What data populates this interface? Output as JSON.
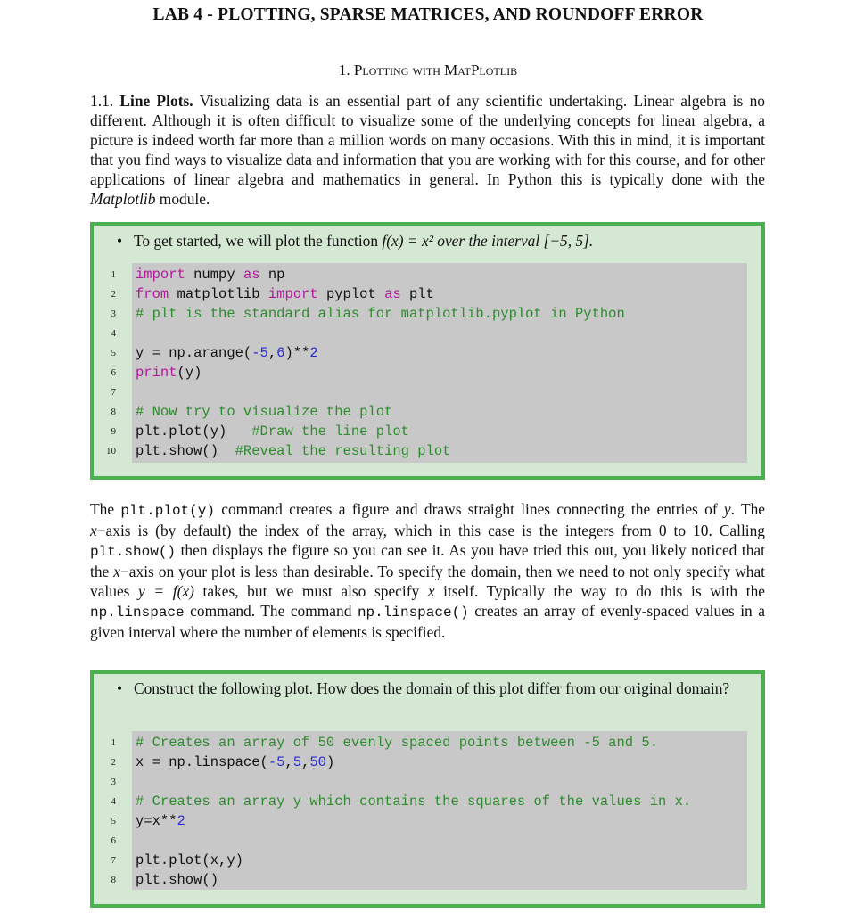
{
  "document": {
    "title": "LAB 4 - PLOTTING, SPARSE MATRICES, AND ROUNDOFF ERROR",
    "section": {
      "number": "1.",
      "title": "Plotting with MatPlotlib"
    },
    "subsection": {
      "number": "1.1.",
      "title": "Line Plots.",
      "text_before_italic": "Visualizing data is an essential part of any scientific undertaking. Linear algebra is no different. Although it is often difficult to visualize some of the underlying concepts for linear algebra, a picture is indeed worth far more than a million words on many occasions. With this in mind, it is important that you find ways to visualize data and information that you are working with for this course, and for other applications of linear algebra and mathematics in general. In Python this is typically done with the",
      "italic": "Matplotlib",
      "text_after_italic": "module."
    },
    "box1": {
      "bullet_symbol": "•",
      "bullet_text_a": "To get started, we will plot the function ",
      "bullet_math": "f(x) = x² over the interval [−5, 5].",
      "code_lines": [
        {
          "n": "1",
          "parts": [
            {
              "t": "import",
              "c": "kw"
            },
            {
              "t": " numpy ",
              "c": ""
            },
            {
              "t": "as",
              "c": "kw"
            },
            {
              "t": " np",
              "c": ""
            }
          ]
        },
        {
          "n": "2",
          "parts": [
            {
              "t": "from",
              "c": "kw"
            },
            {
              "t": " matplotlib ",
              "c": ""
            },
            {
              "t": "import",
              "c": "kw"
            },
            {
              "t": " pyplot ",
              "c": ""
            },
            {
              "t": "as",
              "c": "kw"
            },
            {
              "t": " plt",
              "c": ""
            }
          ]
        },
        {
          "n": "3",
          "parts": [
            {
              "t": "# plt is the standard alias for matplotlib.pyplot in Python",
              "c": "cm"
            }
          ]
        },
        {
          "n": "4",
          "parts": []
        },
        {
          "n": "5",
          "parts": [
            {
              "t": "y = np.arange(",
              "c": ""
            },
            {
              "t": "-5",
              "c": "num"
            },
            {
              "t": ",",
              "c": ""
            },
            {
              "t": "6",
              "c": "num"
            },
            {
              "t": ")**",
              "c": ""
            },
            {
              "t": "2",
              "c": "num"
            }
          ]
        },
        {
          "n": "6",
          "parts": [
            {
              "t": "print",
              "c": "kw"
            },
            {
              "t": "(y)",
              "c": ""
            }
          ]
        },
        {
          "n": "7",
          "parts": []
        },
        {
          "n": "8",
          "parts": [
            {
              "t": "# Now try to visualize the plot",
              "c": "cm"
            }
          ]
        },
        {
          "n": "9",
          "parts": [
            {
              "t": "plt.plot(y)   ",
              "c": ""
            },
            {
              "t": "#Draw the line plot",
              "c": "cm"
            }
          ]
        },
        {
          "n": "10",
          "parts": [
            {
              "t": "plt.show()  ",
              "c": ""
            },
            {
              "t": "#Reveal the resulting plot",
              "c": "cm"
            }
          ]
        }
      ]
    },
    "para2": {
      "segments": [
        {
          "t": "The ",
          "c": ""
        },
        {
          "t": "plt.plot(y)",
          "c": "code"
        },
        {
          "t": " command creates a figure and draws straight lines connecting the entries of ",
          "c": ""
        },
        {
          "t": "y",
          "c": "i"
        },
        {
          "t": ". The ",
          "c": ""
        },
        {
          "t": "x",
          "c": "i"
        },
        {
          "t": "−axis is (by default) the index of the array, which in this case is the integers from 0 to 10. Calling ",
          "c": ""
        },
        {
          "t": "plt.show()",
          "c": "code"
        },
        {
          "t": " then displays the figure so you can see it. As you have tried this out, you likely noticed that the ",
          "c": ""
        },
        {
          "t": "x",
          "c": "i"
        },
        {
          "t": "−axis on your plot is less than desirable. To specify the domain, then we need to not only specify what values ",
          "c": ""
        },
        {
          "t": "y = f(x)",
          "c": "i"
        },
        {
          "t": " takes, but we must also specify ",
          "c": ""
        },
        {
          "t": "x",
          "c": "i"
        },
        {
          "t": " itself. Typically the way to do this is with the ",
          "c": ""
        },
        {
          "t": "np.linspace",
          "c": "code"
        },
        {
          "t": " command. The command ",
          "c": ""
        },
        {
          "t": "np.linspace()",
          "c": "code"
        },
        {
          "t": " creates an array of evenly-spaced values in a given interval where the number of elements is specified.",
          "c": ""
        }
      ]
    },
    "box2": {
      "bullet_symbol": "•",
      "bullet_text": "Construct the following plot. How does the domain of this plot differ from our original domain?",
      "code_lines": [
        {
          "n": "1",
          "parts": [
            {
              "t": "# Creates an array of 50 evenly spaced points between -5 and 5.",
              "c": "cm"
            }
          ]
        },
        {
          "n": "2",
          "parts": [
            {
              "t": "x = np.linspace(",
              "c": ""
            },
            {
              "t": "-5",
              "c": "num"
            },
            {
              "t": ",",
              "c": ""
            },
            {
              "t": "5",
              "c": "num"
            },
            {
              "t": ",",
              "c": ""
            },
            {
              "t": "50",
              "c": "num"
            },
            {
              "t": ")",
              "c": ""
            }
          ]
        },
        {
          "n": "3",
          "parts": []
        },
        {
          "n": "4",
          "parts": [
            {
              "t": "# Creates an array y which contains the squares of the values in x.",
              "c": "cm"
            }
          ]
        },
        {
          "n": "5",
          "parts": [
            {
              "t": "y=x**",
              "c": ""
            },
            {
              "t": "2",
              "c": "num"
            }
          ]
        },
        {
          "n": "6",
          "parts": []
        },
        {
          "n": "7",
          "parts": [
            {
              "t": "plt.plot(x,y)",
              "c": ""
            }
          ]
        },
        {
          "n": "8",
          "parts": [
            {
              "t": "plt.show()",
              "c": ""
            }
          ]
        }
      ]
    },
    "colors": {
      "box_border": "#4caf50",
      "box_fill": "#d5e8d4",
      "code_bg": "#c8c8c8",
      "keyword": "#b5179e",
      "number": "#2b2bd6",
      "comment": "#2e8b2e"
    }
  }
}
